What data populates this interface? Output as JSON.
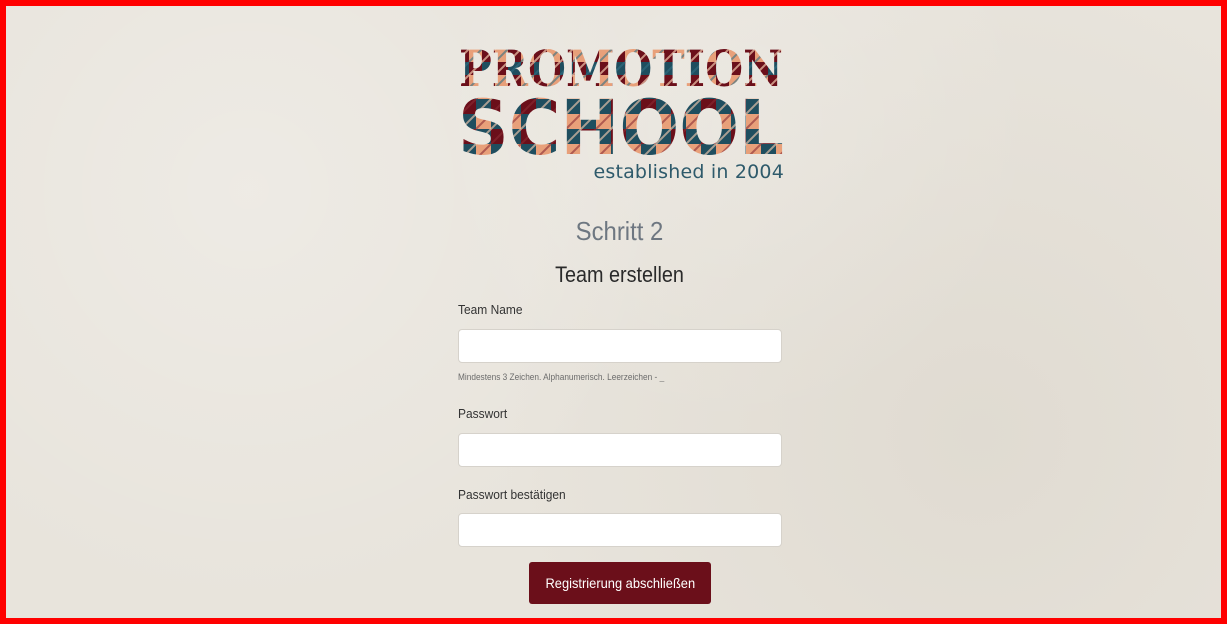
{
  "logo": {
    "line1": "PROMOTION",
    "line2": "SCHOOL",
    "tagline": "established in 2004",
    "colors": {
      "maroon": "#6b0f1a",
      "teal": "#1f4e5f",
      "peach": "#e8a07a"
    }
  },
  "step": {
    "title": "Schritt 2",
    "subtitle": "Team erstellen"
  },
  "form": {
    "team_name": {
      "label": "Team Name",
      "value": "",
      "placeholder": "",
      "hint": "Mindestens 3 Zeichen. Alphanumerisch. Leerzeichen - _"
    },
    "password": {
      "label": "Passwort",
      "value": "",
      "placeholder": ""
    },
    "password_confirm": {
      "label": "Passwort bestätigen",
      "value": "",
      "placeholder": ""
    },
    "submit_label": "Registrierung abschließen"
  },
  "colors": {
    "frame_border": "#ff0000",
    "background": "#e8e4dc",
    "button": "#6b0f1a"
  }
}
